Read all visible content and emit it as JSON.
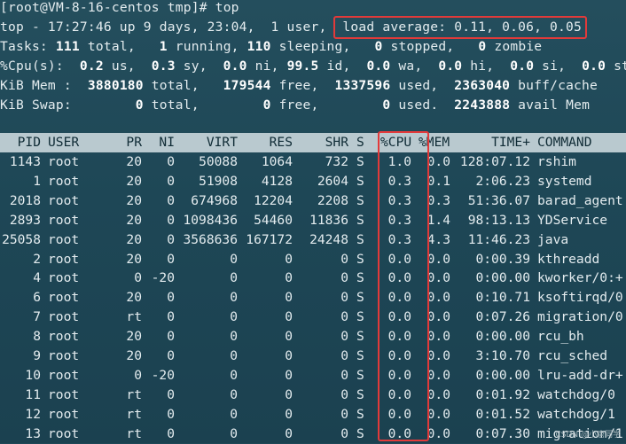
{
  "prompt": {
    "user": "root",
    "host": "VM-8-16-centos",
    "dir": "tmp",
    "command": "top"
  },
  "summary": {
    "uptime_text": "top - 17:27:46 up 9 days, 23:04,  1 user,",
    "load_average": "load average: 0.11, 0.06, 0.05",
    "tasks": {
      "label": "Tasks:",
      "total": "111",
      "total_label": "total,",
      "running": "1",
      "running_label": "running,",
      "sleeping": "110",
      "sleeping_label": "sleeping,",
      "stopped": "0",
      "stopped_label": "stopped,",
      "zombie": "0",
      "zombie_label": "zombie"
    },
    "cpu": {
      "label": "%Cpu(s):",
      "us": "0.2",
      "sy": "0.3",
      "ni": "0.0",
      "id": "99.5",
      "wa": "0.0",
      "hi": "0.0",
      "si": "0.0",
      "st": "0.0"
    },
    "mem": {
      "label": "KiB Mem :",
      "total": "3880180",
      "free": "179544",
      "used": "1337596",
      "buff_cache": "2363040"
    },
    "swap": {
      "label": "KiB Swap:",
      "total": "0",
      "free": "0",
      "used": "0",
      "avail_mem": "2243888"
    }
  },
  "columns": [
    "PID",
    "USER",
    "PR",
    "NI",
    "VIRT",
    "RES",
    "SHR",
    "S",
    "%CPU",
    "%MEM",
    "TIME+",
    "COMMAND"
  ],
  "processes": [
    {
      "pid": "1143",
      "user": "root",
      "pr": "20",
      "ni": "0",
      "virt": "50088",
      "res": "1064",
      "shr": "732",
      "s": "S",
      "cpu": "1.0",
      "mem": "0.0",
      "time": "128:07.12",
      "command": "rshim"
    },
    {
      "pid": "1",
      "user": "root",
      "pr": "20",
      "ni": "0",
      "virt": "51908",
      "res": "4128",
      "shr": "2604",
      "s": "S",
      "cpu": "0.3",
      "mem": "0.1",
      "time": "2:06.23",
      "command": "systemd"
    },
    {
      "pid": "2018",
      "user": "root",
      "pr": "20",
      "ni": "0",
      "virt": "674968",
      "res": "12204",
      "shr": "2208",
      "s": "S",
      "cpu": "0.3",
      "mem": "0.3",
      "time": "51:36.07",
      "command": "barad_agent"
    },
    {
      "pid": "2893",
      "user": "root",
      "pr": "20",
      "ni": "0",
      "virt": "1098436",
      "res": "54460",
      "shr": "11836",
      "s": "S",
      "cpu": "0.3",
      "mem": "1.4",
      "time": "98:13.13",
      "command": "YDService"
    },
    {
      "pid": "25058",
      "user": "root",
      "pr": "20",
      "ni": "0",
      "virt": "3568636",
      "res": "167172",
      "shr": "24248",
      "s": "S",
      "cpu": "0.3",
      "mem": "4.3",
      "time": "11:46.23",
      "command": "java"
    },
    {
      "pid": "2",
      "user": "root",
      "pr": "20",
      "ni": "0",
      "virt": "0",
      "res": "0",
      "shr": "0",
      "s": "S",
      "cpu": "0.0",
      "mem": "0.0",
      "time": "0:00.39",
      "command": "kthreadd"
    },
    {
      "pid": "4",
      "user": "root",
      "pr": "0",
      "ni": "-20",
      "virt": "0",
      "res": "0",
      "shr": "0",
      "s": "S",
      "cpu": "0.0",
      "mem": "0.0",
      "time": "0:00.00",
      "command": "kworker/0:+"
    },
    {
      "pid": "6",
      "user": "root",
      "pr": "20",
      "ni": "0",
      "virt": "0",
      "res": "0",
      "shr": "0",
      "s": "S",
      "cpu": "0.0",
      "mem": "0.0",
      "time": "0:10.71",
      "command": "ksoftirqd/0"
    },
    {
      "pid": "7",
      "user": "root",
      "pr": "rt",
      "ni": "0",
      "virt": "0",
      "res": "0",
      "shr": "0",
      "s": "S",
      "cpu": "0.0",
      "mem": "0.0",
      "time": "0:07.26",
      "command": "migration/0"
    },
    {
      "pid": "8",
      "user": "root",
      "pr": "20",
      "ni": "0",
      "virt": "0",
      "res": "0",
      "shr": "0",
      "s": "S",
      "cpu": "0.0",
      "mem": "0.0",
      "time": "0:00.00",
      "command": "rcu_bh"
    },
    {
      "pid": "9",
      "user": "root",
      "pr": "20",
      "ni": "0",
      "virt": "0",
      "res": "0",
      "shr": "0",
      "s": "S",
      "cpu": "0.0",
      "mem": "0.0",
      "time": "3:10.70",
      "command": "rcu_sched"
    },
    {
      "pid": "10",
      "user": "root",
      "pr": "0",
      "ni": "-20",
      "virt": "0",
      "res": "0",
      "shr": "0",
      "s": "S",
      "cpu": "0.0",
      "mem": "0.0",
      "time": "0:00.00",
      "command": "lru-add-dr+"
    },
    {
      "pid": "11",
      "user": "root",
      "pr": "rt",
      "ni": "0",
      "virt": "0",
      "res": "0",
      "shr": "0",
      "s": "S",
      "cpu": "0.0",
      "mem": "0.0",
      "time": "0:01.92",
      "command": "watchdog/0"
    },
    {
      "pid": "12",
      "user": "root",
      "pr": "rt",
      "ni": "0",
      "virt": "0",
      "res": "0",
      "shr": "0",
      "s": "S",
      "cpu": "0.0",
      "mem": "0.0",
      "time": "0:01.52",
      "command": "watchdog/1"
    },
    {
      "pid": "13",
      "user": "root",
      "pr": "rt",
      "ni": "0",
      "virt": "0",
      "res": "0",
      "shr": "0",
      "s": "S",
      "cpu": "0.0",
      "mem": "0.0",
      "time": "0:07.30",
      "command": "migration/1"
    }
  ],
  "watermark": "CSDN @小唐同学",
  "colors": {
    "background": "#1f4756",
    "highlight": "#e23a3a",
    "header_bg": "#b9c9cf"
  }
}
